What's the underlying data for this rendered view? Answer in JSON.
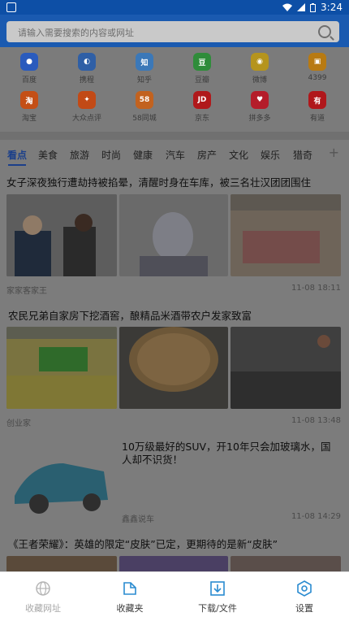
{
  "status": {
    "time": "3:24"
  },
  "search": {
    "placeholder": "请输入需要搜索的内容或网址"
  },
  "shortcuts": [
    {
      "label": "百度",
      "icon": "paw-icon",
      "glyph": "●",
      "color": "#2a5bbd"
    },
    {
      "label": "携程",
      "icon": "dolphin-icon",
      "glyph": "◐",
      "color": "#2f5fa6"
    },
    {
      "label": "知乎",
      "icon": "zhihu-icon",
      "glyph": "知",
      "color": "#3b78b8"
    },
    {
      "label": "豆瓣",
      "icon": "douban-icon",
      "glyph": "豆",
      "color": "#2f8c3a"
    },
    {
      "label": "微博",
      "icon": "weibo-icon",
      "glyph": "◉",
      "color": "#b5941d"
    },
    {
      "label": "4399",
      "icon": "4399-icon",
      "glyph": "▣",
      "color": "#b87a12"
    },
    {
      "label": "淘宝",
      "icon": "taobao-icon",
      "glyph": "淘",
      "color": "#c44f16"
    },
    {
      "label": "大众点评",
      "icon": "dianping-icon",
      "glyph": "✦",
      "color": "#c24a16"
    },
    {
      "label": "58同城",
      "icon": "58-icon",
      "glyph": "58",
      "color": "#c2621f"
    },
    {
      "label": "京东",
      "icon": "jd-icon",
      "glyph": "JD",
      "color": "#b0191b"
    },
    {
      "label": "拼多多",
      "icon": "pinduoduo-icon",
      "glyph": "♥",
      "color": "#b41d2a"
    },
    {
      "label": "有道",
      "icon": "youdao-icon",
      "glyph": "有",
      "color": "#b0171b"
    }
  ],
  "tabs": [
    "看点",
    "美食",
    "旅游",
    "时尚",
    "健康",
    "汽车",
    "房产",
    "文化",
    "娱乐",
    "猎奇"
  ],
  "tab_plus": "+",
  "feed": [
    {
      "title": "女子深夜独行遭劫持被掐晕，清醒时身在车库，被三名壮汉团团围住",
      "source": "家家客家王",
      "time": "11-08 18:11"
    },
    {
      "title": "农民兄弟自家房下挖酒窖，酿精品米酒带农户发家致富",
      "source": "创业家",
      "time": "11-08 13:48"
    },
    {
      "title": "10万级最好的SUV，开10年只会加玻璃水，国人却不识货！",
      "source": "鑫鑫说车",
      "time": "11-08 14:29"
    },
    {
      "title": "《王者荣耀》：英雄的限定“皮肤”已定，更期待的是新“皮肤”"
    }
  ],
  "bottom_nav": [
    {
      "label": "收藏网址",
      "icon": "globe-icon"
    },
    {
      "label": "收藏夹",
      "icon": "folder-icon"
    },
    {
      "label": "下载/文件",
      "icon": "download-icon"
    },
    {
      "label": "设置",
      "icon": "gear-icon"
    }
  ]
}
